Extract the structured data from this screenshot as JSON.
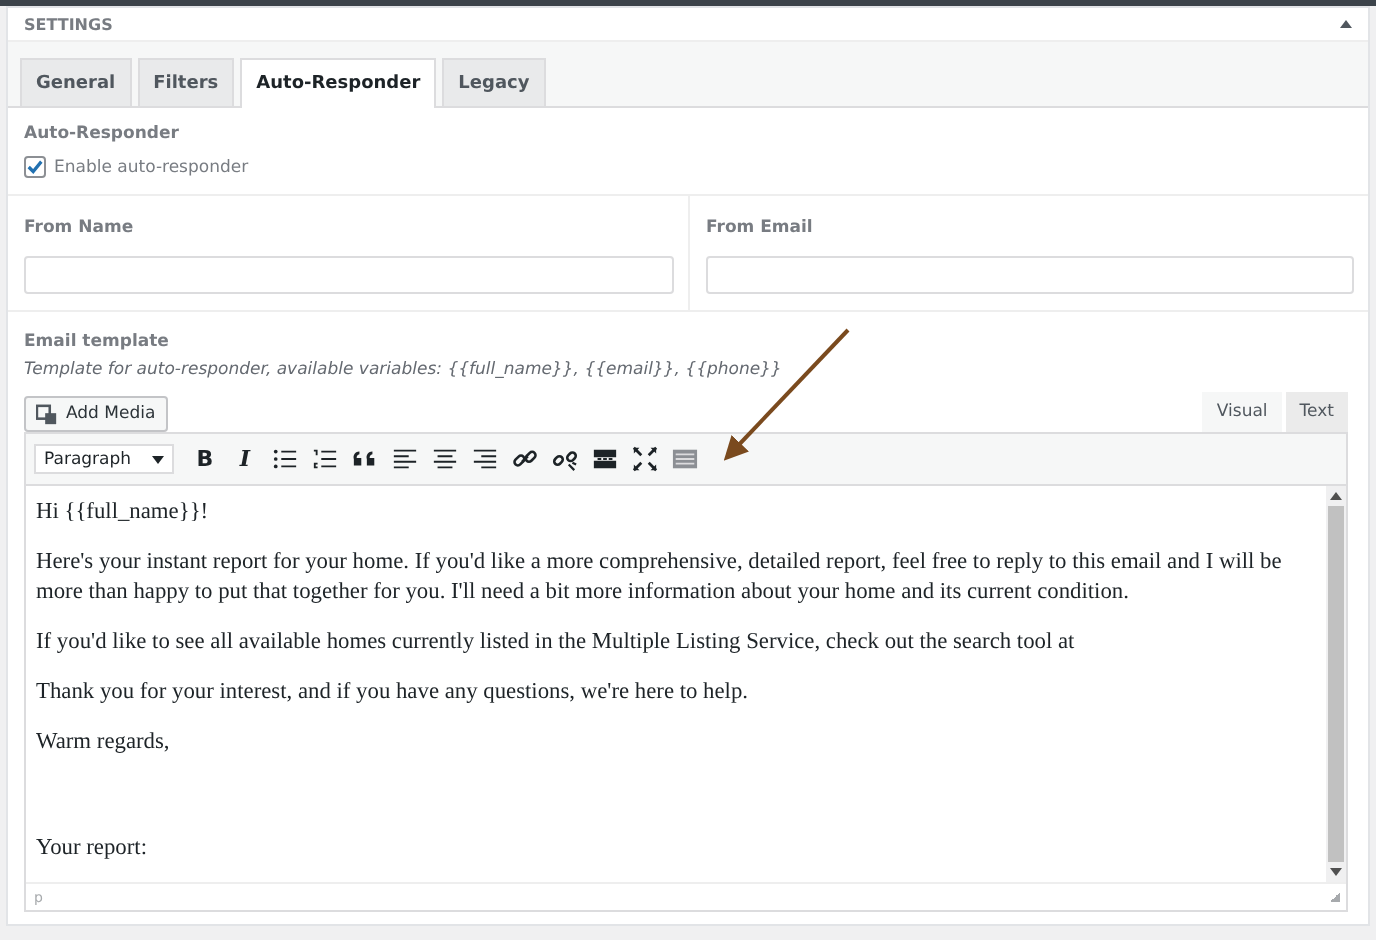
{
  "panel": {
    "title": "SETTINGS"
  },
  "tabs": [
    {
      "label": "General",
      "selected": false
    },
    {
      "label": "Filters",
      "selected": false
    },
    {
      "label": "Auto-Responder",
      "selected": true
    },
    {
      "label": "Legacy",
      "selected": false
    }
  ],
  "auto_responder": {
    "heading": "Auto-Responder",
    "checkbox": {
      "label": "Enable auto-responder",
      "checked": true
    }
  },
  "fields": [
    {
      "label": "From Name"
    },
    {
      "label": "From Email"
    }
  ],
  "template": {
    "label": "Email template",
    "description": "Template for auto-responder, available variables: {{full_name}}, {{email}}, {{phone}}",
    "add_media": "Add Media",
    "editor_tabs": [
      {
        "label": "Visual",
        "selected": true
      },
      {
        "label": "Text",
        "selected": false
      }
    ],
    "format": "Paragraph",
    "toolbar": [
      {
        "kind": "bold",
        "label": "B"
      },
      {
        "kind": "italic",
        "label": "I"
      },
      {
        "kind": "bullets"
      },
      {
        "kind": "numbers"
      },
      {
        "kind": "quote"
      },
      {
        "kind": "align-left"
      },
      {
        "kind": "align-center"
      },
      {
        "kind": "align-right"
      },
      {
        "kind": "link"
      },
      {
        "kind": "unlink"
      },
      {
        "kind": "more"
      },
      {
        "kind": "fullscreen"
      },
      {
        "kind": "toolbar-toggle"
      }
    ],
    "content": [
      {
        "kind": "text",
        "text": "Hi {{full_name}}!"
      },
      {
        "kind": "text",
        "text": "Here's your instant report for your home. If you'd like a more comprehensive, detailed report, feel free to reply to this email and I will be more than happy to put that together for you. I'll need a bit more information about your home and its current condition."
      },
      {
        "kind": "text",
        "text": "If you'd like to see all available homes currently listed in the Multiple Listing Service, check out the search tool at"
      },
      {
        "kind": "text",
        "text": "Thank you for your interest, and if you have any questions, we're here to help."
      },
      {
        "kind": "text",
        "text": "Warm regards,"
      },
      {
        "kind": "spacer"
      },
      {
        "kind": "text",
        "text": "Your report:"
      }
    ],
    "path": "p"
  }
}
